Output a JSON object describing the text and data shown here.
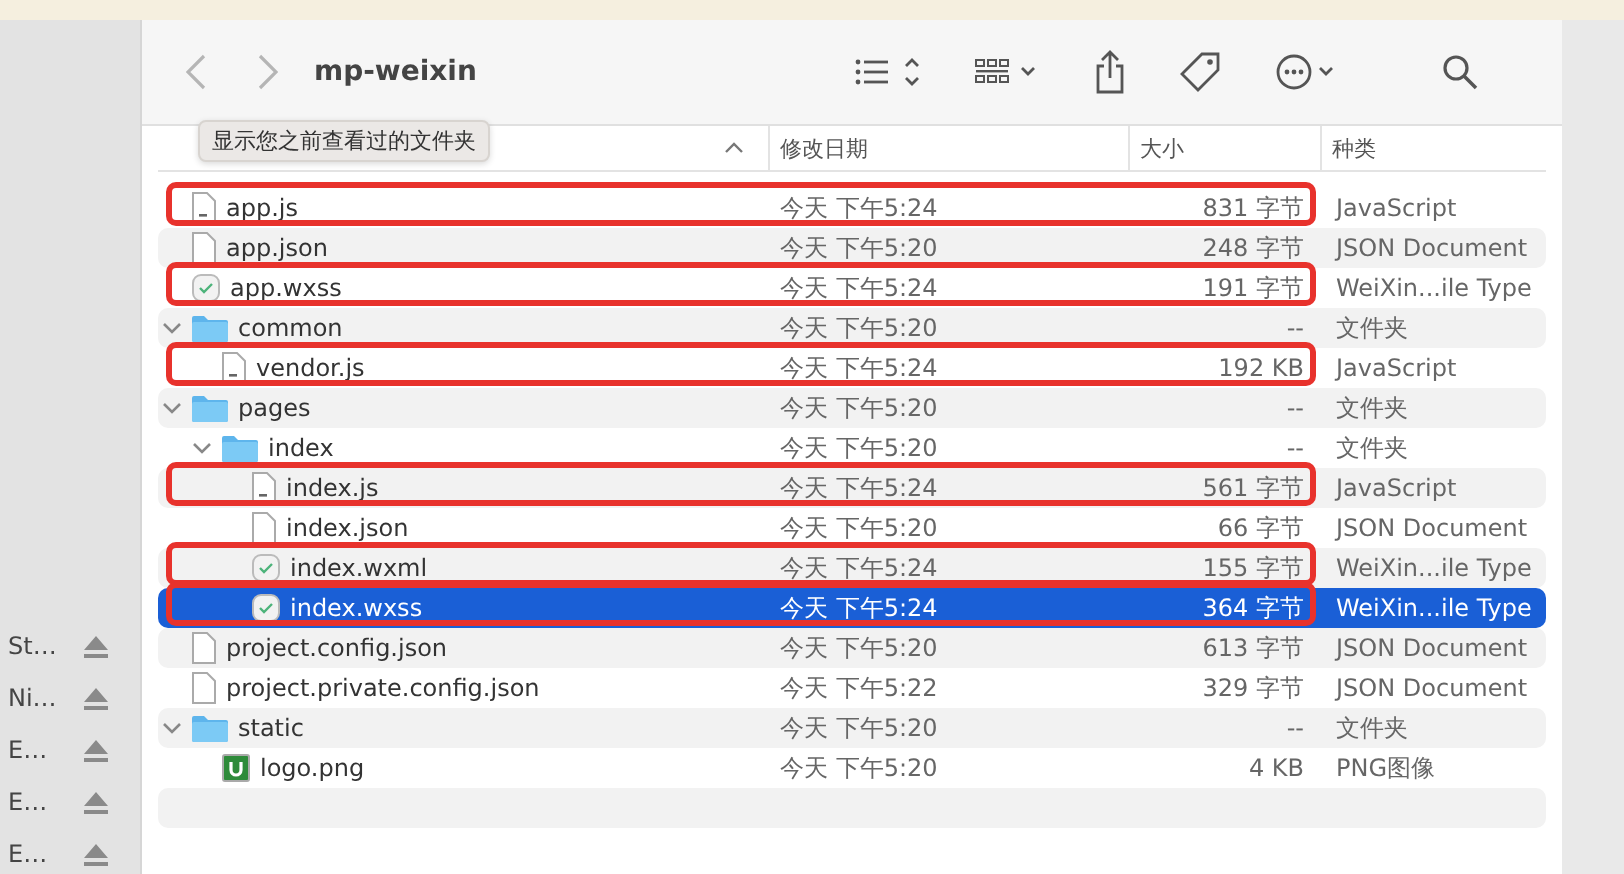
{
  "sidebar": {
    "items": [
      {
        "label": "St…"
      },
      {
        "label": "Ni…"
      },
      {
        "label": "E…"
      },
      {
        "label": "E…"
      },
      {
        "label": "E…"
      }
    ]
  },
  "window": {
    "title": "mp-weixin"
  },
  "tooltip": "显示您之前查看过的文件夹",
  "columns": [
    {
      "label": "修改日期"
    },
    {
      "label": "大小"
    },
    {
      "label": "种类"
    }
  ],
  "files": [
    {
      "name": "app.js",
      "kind": "js",
      "date": "今天 下午5:24",
      "size": "831 字节",
      "type": "JavaScript",
      "selected": false,
      "annotated": true
    },
    {
      "name": "app.json",
      "kind": "doc",
      "date": "今天 下午5:20",
      "size": "248 字节",
      "type": "JSON Document",
      "selected": false,
      "annotated": false
    },
    {
      "name": "app.wxss",
      "kind": "wx",
      "date": "今天 下午5:24",
      "size": "191 字节",
      "type": "WeiXin...ile Type",
      "selected": false,
      "annotated": true
    },
    {
      "name": "common",
      "kind": "folder",
      "expanded": true,
      "date": "今天 下午5:20",
      "size": "--",
      "type": "文件夹",
      "selected": false,
      "annotated": false,
      "children": [
        {
          "name": "vendor.js",
          "kind": "js",
          "date": "今天 下午5:24",
          "size": "192 KB",
          "type": "JavaScript",
          "selected": false,
          "annotated": true
        }
      ]
    },
    {
      "name": "pages",
      "kind": "folder",
      "expanded": true,
      "date": "今天 下午5:20",
      "size": "--",
      "type": "文件夹",
      "selected": false,
      "annotated": false,
      "children": [
        {
          "name": "index",
          "kind": "folder",
          "expanded": true,
          "date": "今天 下午5:20",
          "size": "--",
          "type": "文件夹",
          "selected": false,
          "annotated": false,
          "children": [
            {
              "name": "index.js",
              "kind": "js",
              "date": "今天 下午5:24",
              "size": "561 字节",
              "type": "JavaScript",
              "selected": false,
              "annotated": true
            },
            {
              "name": "index.json",
              "kind": "doc",
              "date": "今天 下午5:20",
              "size": "66 字节",
              "type": "JSON Document",
              "selected": false,
              "annotated": false
            },
            {
              "name": "index.wxml",
              "kind": "wx",
              "date": "今天 下午5:24",
              "size": "155 字节",
              "type": "WeiXin...ile Type",
              "selected": false,
              "annotated": true
            },
            {
              "name": "index.wxss",
              "kind": "wx",
              "date": "今天 下午5:24",
              "size": "364 字节",
              "type": "WeiXin...ile Type",
              "selected": true,
              "annotated": true
            }
          ]
        }
      ]
    },
    {
      "name": "project.config.json",
      "kind": "doc",
      "date": "今天 下午5:20",
      "size": "613 字节",
      "type": "JSON Document",
      "selected": false,
      "annotated": false
    },
    {
      "name": "project.private.config.json",
      "kind": "doc",
      "date": "今天 下午5:22",
      "size": "329 字节",
      "type": "JSON Document",
      "selected": false,
      "annotated": false
    },
    {
      "name": "static",
      "kind": "folder",
      "expanded": true,
      "date": "今天 下午5:20",
      "size": "--",
      "type": "文件夹",
      "selected": false,
      "annotated": false,
      "children": [
        {
          "name": "logo.png",
          "kind": "png",
          "date": "今天 下午5:20",
          "size": "4 KB",
          "type": "PNG图像",
          "selected": false,
          "annotated": false
        }
      ]
    }
  ]
}
